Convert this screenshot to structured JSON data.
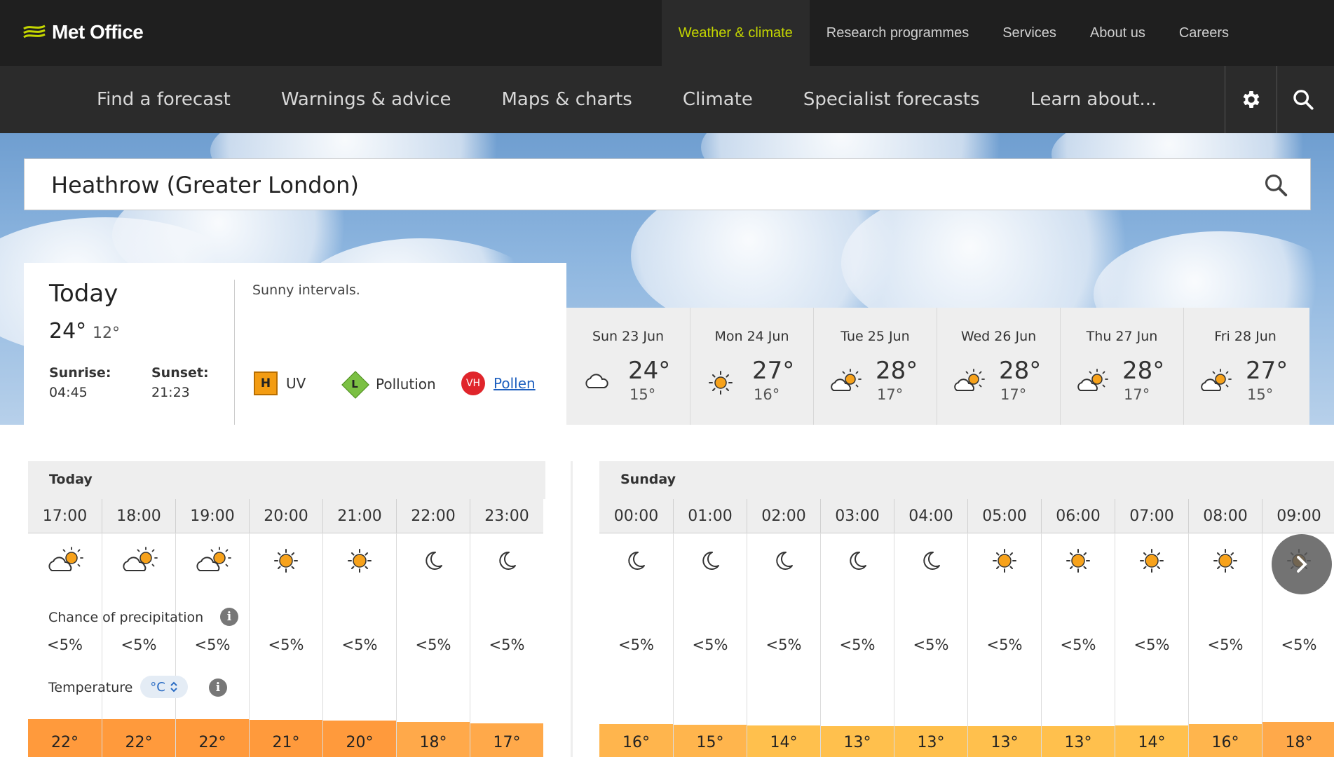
{
  "brand": {
    "name": "Met Office"
  },
  "top_nav": [
    {
      "label": "Weather & climate",
      "active": true
    },
    {
      "label": "Research programmes",
      "active": false
    },
    {
      "label": "Services",
      "active": false
    },
    {
      "label": "About us",
      "active": false
    },
    {
      "label": "Careers",
      "active": false
    }
  ],
  "main_nav": [
    "Find a forecast",
    "Warnings & advice",
    "Maps & charts",
    "Climate",
    "Specialist forecasts",
    "Learn about..."
  ],
  "search": {
    "value": "Heathrow (Greater London)"
  },
  "today": {
    "title": "Today",
    "high": "24°",
    "low": "12°",
    "sunrise_label": "Sunrise:",
    "sunrise": "04:45",
    "sunset_label": "Sunset:",
    "sunset": "21:23",
    "summary": "Sunny intervals.",
    "uv": {
      "code": "H",
      "label": "UV"
    },
    "pollution": {
      "code": "L",
      "label": "Pollution"
    },
    "pollen": {
      "code": "VH",
      "label": "Pollen"
    }
  },
  "days": [
    {
      "name": "Sun 23 Jun",
      "icon": "cloud-icon",
      "high": "24°",
      "low": "15°"
    },
    {
      "name": "Mon 24 Jun",
      "icon": "sun-icon",
      "high": "27°",
      "low": "16°"
    },
    {
      "name": "Tue 25 Jun",
      "icon": "sunny-intervals-icon",
      "high": "28°",
      "low": "17°"
    },
    {
      "name": "Wed 26 Jun",
      "icon": "sunny-intervals-icon",
      "high": "28°",
      "low": "17°"
    },
    {
      "name": "Thu 27 Jun",
      "icon": "sunny-intervals-icon",
      "high": "28°",
      "low": "17°"
    },
    {
      "name": "Fri 28 Jun",
      "icon": "sunny-intervals-icon",
      "high": "27°",
      "low": "15°"
    }
  ],
  "hourly_today": {
    "label": "Today",
    "hours": [
      {
        "time": "17:00",
        "icon": "sunny-intervals-icon",
        "precip": "<5%",
        "temp": "22°"
      },
      {
        "time": "18:00",
        "icon": "sunny-intervals-icon",
        "precip": "<5%",
        "temp": "22°"
      },
      {
        "time": "19:00",
        "icon": "sunny-intervals-icon",
        "precip": "<5%",
        "temp": "22°"
      },
      {
        "time": "20:00",
        "icon": "sun-icon",
        "precip": "<5%",
        "temp": "21°"
      },
      {
        "time": "21:00",
        "icon": "sun-icon",
        "precip": "<5%",
        "temp": "20°"
      },
      {
        "time": "22:00",
        "icon": "moon-icon",
        "precip": "<5%",
        "temp": "18°"
      },
      {
        "time": "23:00",
        "icon": "moon-icon",
        "precip": "<5%",
        "temp": "17°"
      }
    ]
  },
  "hourly_sunday": {
    "label": "Sunday",
    "hours": [
      {
        "time": "00:00",
        "icon": "moon-icon",
        "precip": "<5%",
        "temp": "16°"
      },
      {
        "time": "01:00",
        "icon": "moon-icon",
        "precip": "<5%",
        "temp": "15°"
      },
      {
        "time": "02:00",
        "icon": "moon-icon",
        "precip": "<5%",
        "temp": "14°"
      },
      {
        "time": "03:00",
        "icon": "moon-icon",
        "precip": "<5%",
        "temp": "13°"
      },
      {
        "time": "04:00",
        "icon": "moon-icon",
        "precip": "<5%",
        "temp": "13°"
      },
      {
        "time": "05:00",
        "icon": "sun-icon",
        "precip": "<5%",
        "temp": "13°"
      },
      {
        "time": "06:00",
        "icon": "sun-icon",
        "precip": "<5%",
        "temp": "13°"
      },
      {
        "time": "07:00",
        "icon": "sun-icon",
        "precip": "<5%",
        "temp": "14°"
      },
      {
        "time": "08:00",
        "icon": "sun-icon",
        "precip": "<5%",
        "temp": "16°"
      },
      {
        "time": "09:00",
        "icon": "sun-icon",
        "precip": "<5%",
        "temp": "18°"
      }
    ]
  },
  "labels": {
    "precip": "Chance of precipitation",
    "temperature": "Temperature",
    "unit": "°C"
  },
  "colors": {
    "accent": "#c4d600",
    "uv_high": "#f39c12",
    "pollution_low": "#7bc043",
    "pollen_very_high": "#e0252b",
    "temp_warm": "#ff9a3c",
    "temp_cool": "#ffc04d"
  }
}
